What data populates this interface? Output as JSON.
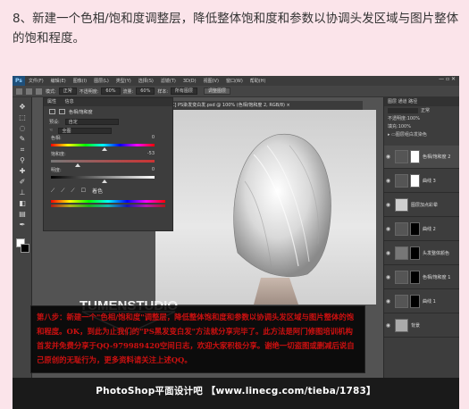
{
  "instruction": "8、新建一个色相/饱和度调整层，降低整体饱和度和参数以协调头发区域与图片整体的饱和程度。",
  "photoshop": {
    "app_logo": "Ps",
    "menu": [
      "文件(F)",
      "编辑(E)",
      "图像(I)",
      "图层(L)",
      "类型(Y)",
      "选择(S)",
      "滤镜(T)",
      "3D(D)",
      "视图(V)",
      "窗口(W)",
      "帮助(H)"
    ],
    "window_controls": "— ▫ ✕",
    "options_bar": {
      "mode_label": "模式:",
      "mode_value": "正常",
      "opacity_label": "不透明度:",
      "opacity_value": "60%",
      "flow_label": "流量:",
      "flow_value": "60%",
      "sample_label": "样本:",
      "sample_value": "所有图层",
      "ignore_btn": "调整图层"
    },
    "document_tab": "[C] PS染发变白发.psd @ 100% (色相/饱和度 2, RGB/8) ×",
    "properties": {
      "tab1": "属性",
      "tab2": "信息",
      "title": "色相/饱和度",
      "preset_label": "预设:",
      "preset_value": "自定",
      "channel_value": "全图",
      "hue_label": "色相:",
      "hue_value": "0",
      "saturation_label": "饱和度:",
      "saturation_value": "-53",
      "lightness_label": "明度:",
      "lightness_value": "0",
      "colorize_label": "着色"
    },
    "layers": {
      "tab1": "图层",
      "tab2": "通道",
      "tab3": "路径",
      "blend_value": "正常",
      "opacity_label": "不透明度:",
      "opacity_value": "100%",
      "fill_label": "填充:",
      "fill_value": "100%",
      "group_name": "图层组白发染色",
      "items": [
        {
          "name": "色相/饱和度 2"
        },
        {
          "name": "曲线 3"
        },
        {
          "name": "图层加点彩晕"
        },
        {
          "name": "曲线 2"
        },
        {
          "name": "头发整体颜色"
        },
        {
          "name": "色相/饱和度 1"
        },
        {
          "name": "曲线 1"
        },
        {
          "name": "背景"
        }
      ]
    },
    "overlay_text": "第八步：新建一个\"色相/饱和度\"调整层，降低整体饱和度和参数以协调头发区域与图片整体的饱和程度。OK，到此为止我们的\"PS黑发变白发\"方法就分享完毕了。此方法是阿门修图培训机构首发并免费分享于QQ-979989420空间日志，欢迎大家积极分享。谢绝一切盗图或删减后说自己原创的无耻行为，更多资料请关注上述QQ。",
    "logo_text": "TUMENSTUDIO",
    "footer": "PhotoShop平面设计吧 【www.linecg.com/tieba/1783】"
  },
  "colors": {
    "page_bg": "#fbe4ea",
    "overlay_text": "#cc1010",
    "ps_bg": "#535353"
  }
}
